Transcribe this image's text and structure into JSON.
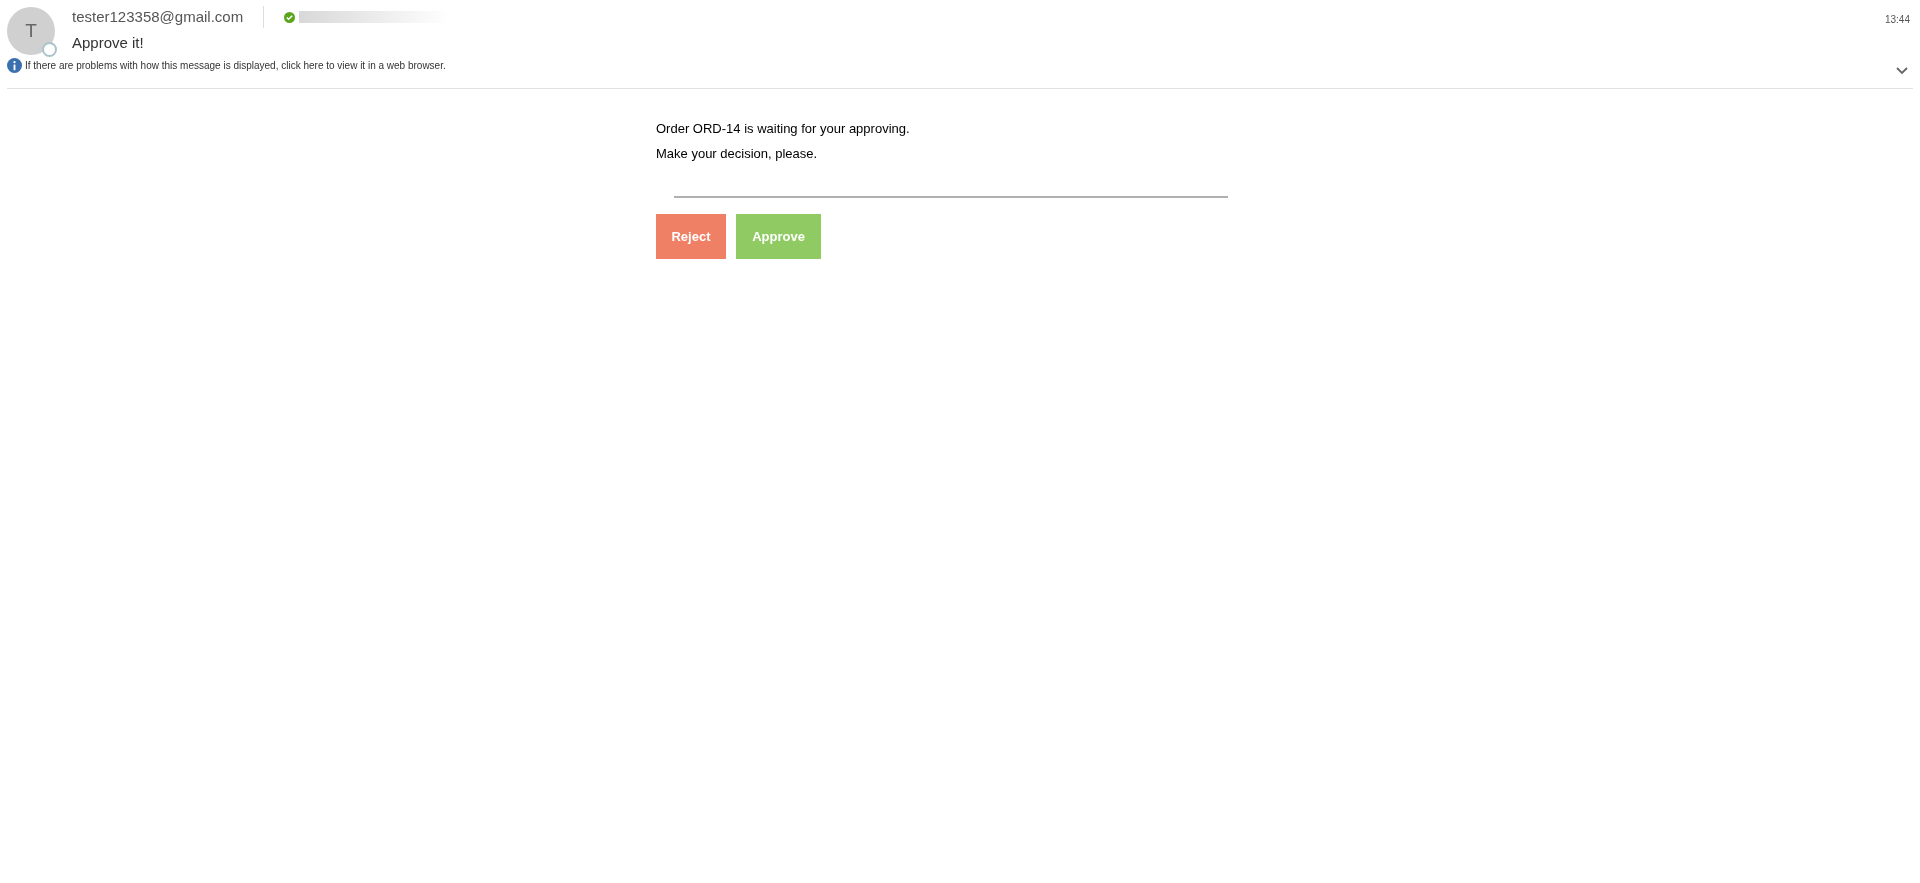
{
  "message": {
    "avatar_initial": "T",
    "sender": "tester123358@gmail.com",
    "verified": true,
    "subject": "Approve it!",
    "time": "13:44",
    "info_bar": "If there are problems with how this message is displayed, click here to view it in a web browser."
  },
  "body": {
    "lines": [
      "Order ORD-14 is waiting for your approving.",
      "Make your decision, please."
    ],
    "buttons": [
      {
        "label": "Reject",
        "kind": "reject"
      },
      {
        "label": "Approve",
        "kind": "approve"
      }
    ]
  }
}
